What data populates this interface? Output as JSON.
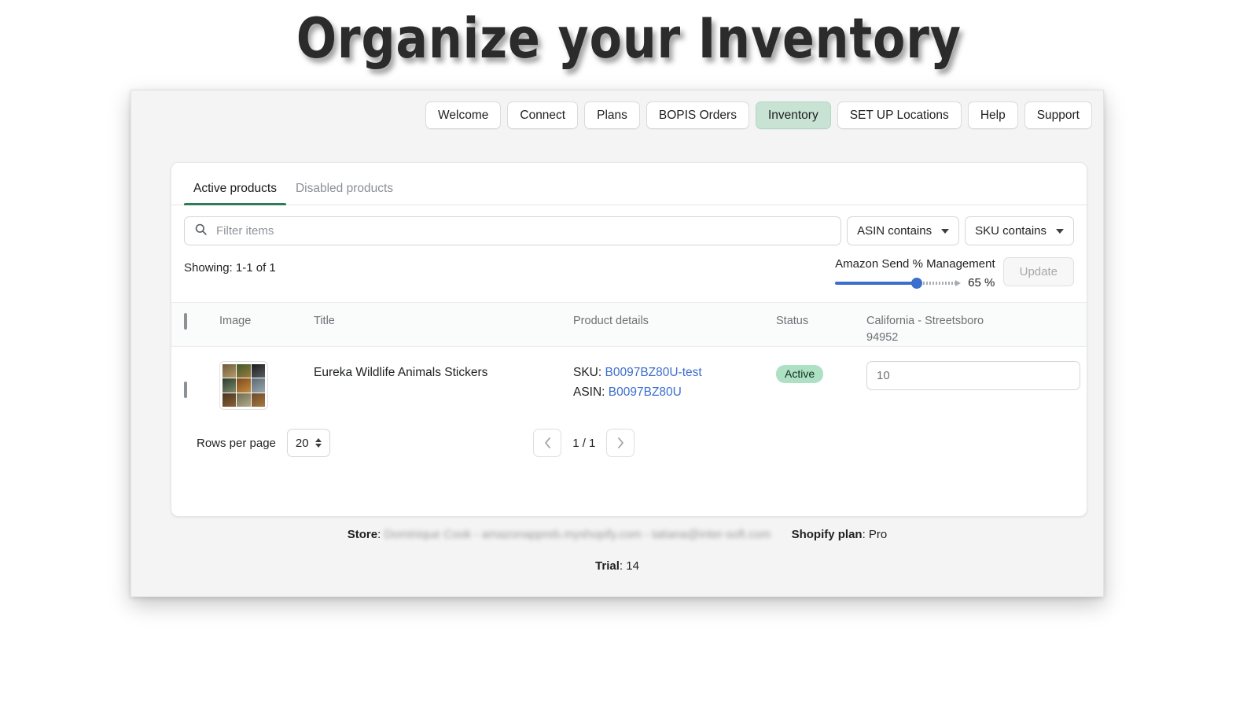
{
  "hero": {
    "title": "Organize your Inventory"
  },
  "topnav": {
    "items": [
      {
        "label": "Welcome",
        "active": false
      },
      {
        "label": "Connect",
        "active": false
      },
      {
        "label": "Plans",
        "active": false
      },
      {
        "label": "BOPIS Orders",
        "active": false
      },
      {
        "label": "Inventory",
        "active": true
      },
      {
        "label": "SET UP Locations",
        "active": false
      },
      {
        "label": "Help",
        "active": false
      },
      {
        "label": "Support",
        "active": false
      }
    ]
  },
  "tabs": [
    {
      "label": "Active products",
      "active": true
    },
    {
      "label": "Disabled products",
      "active": false
    }
  ],
  "filter": {
    "search_icon": "search-icon",
    "search_value": "",
    "search_placeholder": "Filter items",
    "dropdowns": [
      {
        "label": "ASIN contains",
        "icon": "chevron-down-icon"
      },
      {
        "label": "SKU contains",
        "icon": "chevron-down-icon"
      }
    ]
  },
  "meta": {
    "showing": "Showing: 1-1 of 1",
    "send_label": "Amazon Send % Management",
    "slider_value": "65 %",
    "slider_percent": 65,
    "update_label": "Update"
  },
  "table": {
    "headers": {
      "image": "Image",
      "title": "Title",
      "details": "Product details",
      "status": "Status",
      "location_line1": "California - Streetsboro",
      "location_line2": "94952"
    },
    "rows": [
      {
        "title": "Eureka Wildlife Animals Stickers",
        "sku_label": "SKU:",
        "sku_value": "B0097BZ80U-test",
        "asin_label": "ASIN:",
        "asin_value": "B0097BZ80U",
        "status": "Active",
        "quantity": "10"
      }
    ]
  },
  "pagination": {
    "rows_per_page_label": "Rows per page",
    "rows_per_page_value": "20",
    "prev_icon": "chevron-left-icon",
    "next_icon": "chevron-right-icon",
    "page_indicator": "1 / 1"
  },
  "footer": {
    "store_label": "Store",
    "store_value": "Dominique Cook - amazonapprеb.myshopify.com - tatiana@inter-soft.com",
    "plan_label": "Shopify plan",
    "plan_value": "Pro",
    "trial_label": "Trial",
    "trial_value": "14"
  },
  "colors": {
    "accent_green": "#2e7d56",
    "active_tab_bg": "#c8e3d4",
    "badge_bg": "#aee0c4",
    "link_blue": "#3b6ecd",
    "slider_blue": "#3b6ecd"
  }
}
